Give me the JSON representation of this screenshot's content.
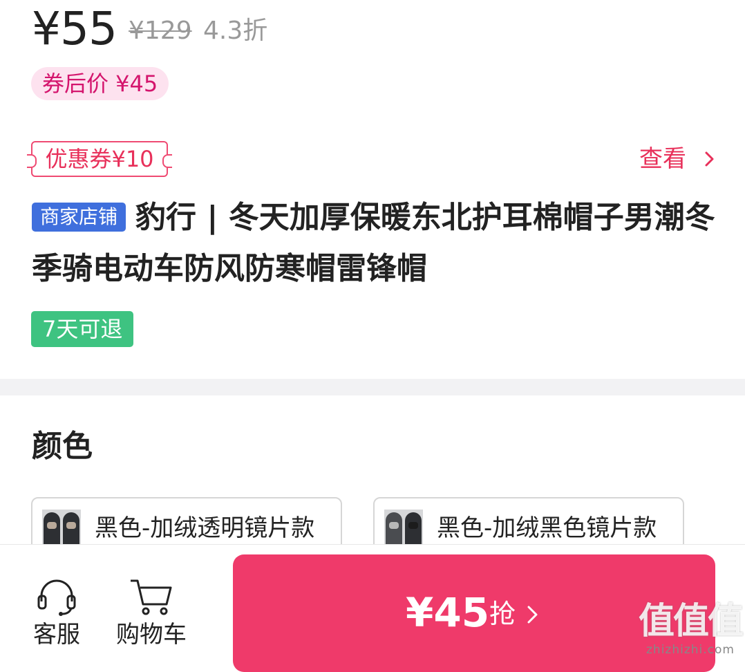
{
  "price": {
    "current": "¥55",
    "original": "¥129",
    "discount": "4.3折",
    "after_coupon": "券后价 ¥45"
  },
  "coupon": {
    "label": "优惠券¥10",
    "view_link": "查看"
  },
  "product": {
    "shop_badge": "商家店铺",
    "title": "豹行 | 冬天加厚保暖东北护耳棉帽子男潮冬季骑电动车防风防寒帽雷锋帽",
    "return_badge": "7天可退"
  },
  "options": {
    "heading": "颜色",
    "items": [
      {
        "label": "黑色-加绒透明镜片款"
      },
      {
        "label": "黑色-加绒黑色镜片款"
      }
    ]
  },
  "bottom_bar": {
    "customer_service": "客服",
    "cart": "购物车",
    "buy_price": "¥45",
    "buy_label": "抢"
  },
  "watermark": {
    "main": "值值值",
    "sub": "zhizhizhi.com"
  },
  "colors": {
    "accent": "#ef3a6a",
    "coupon_pink": "#e8305a",
    "shop_badge_blue": "#3f6fdd",
    "return_badge_green": "#3ec381"
  }
}
